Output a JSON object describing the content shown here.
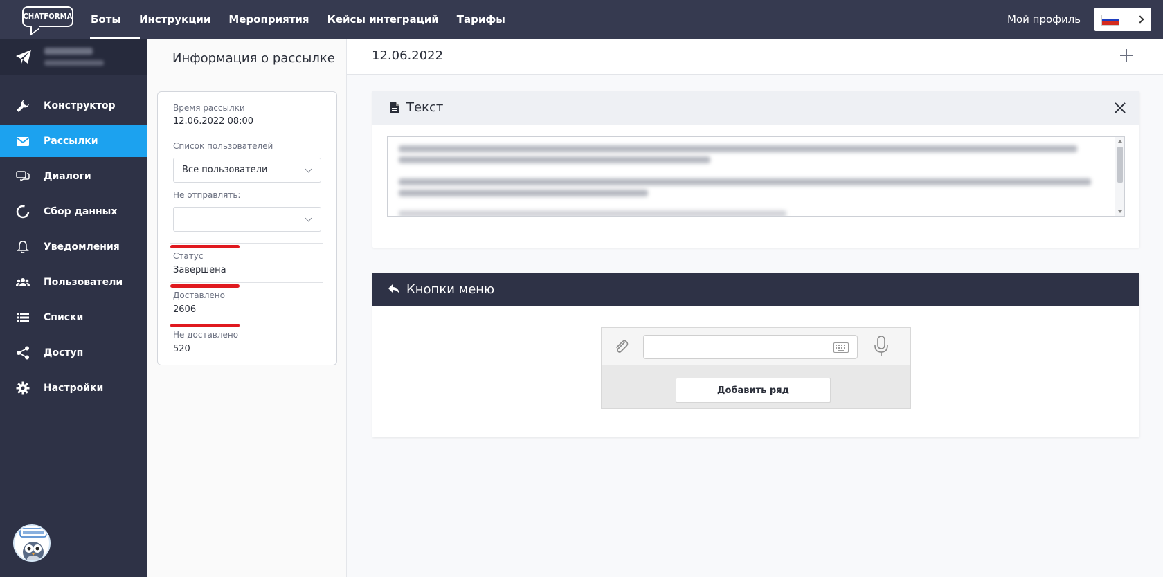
{
  "app": {
    "logo_text": "CHATFORMA"
  },
  "topnav": {
    "items": [
      {
        "label": "Боты",
        "active": true
      },
      {
        "label": "Инструкции"
      },
      {
        "label": "Мероприятия"
      },
      {
        "label": "Кейсы интеграций"
      },
      {
        "label": "Тарифы"
      }
    ],
    "profile_label": "Мой профиль",
    "language": "ru-flag-icon"
  },
  "sidebar": {
    "items": [
      {
        "label": "Конструктор",
        "icon": "wrench-icon"
      },
      {
        "label": "Рассылки",
        "icon": "envelope-icon",
        "active": true
      },
      {
        "label": "Диалоги",
        "icon": "chat-icon"
      },
      {
        "label": "Сбор данных",
        "icon": "progress-circle-icon"
      },
      {
        "label": "Уведомления",
        "icon": "bell-icon"
      },
      {
        "label": "Пользователи",
        "icon": "users-icon"
      },
      {
        "label": "Списки",
        "icon": "list-icon"
      },
      {
        "label": "Доступ",
        "icon": "share-icon"
      },
      {
        "label": "Настройки",
        "icon": "gear-icon"
      }
    ],
    "active_color": "#1ca2ef",
    "bg_color": "#2e3246"
  },
  "info_panel": {
    "title": "Информация о рассылке",
    "send_time_label": "Время рассылки",
    "send_time_value": "12.06.2022 08:00",
    "user_list_label": "Список пользователей",
    "user_list_value": "Все пользователи",
    "exclude_label": "Не отправлять:",
    "exclude_value": "",
    "status_label": "Статус",
    "status_value": "Завершена",
    "delivered_label": "Доставлено",
    "delivered_value": "2606",
    "not_delivered_label": "Не доставлено",
    "not_delivered_value": "520"
  },
  "main": {
    "date_title": "12.06.2022",
    "text_card": {
      "title": "Текст"
    },
    "menu_card": {
      "title": "Кнопки меню",
      "add_row_label": "Добавить ряд"
    }
  },
  "colors": {
    "topbar": "#363a50",
    "accent": "#1ca2ef",
    "highlight_red": "#e0191f"
  }
}
